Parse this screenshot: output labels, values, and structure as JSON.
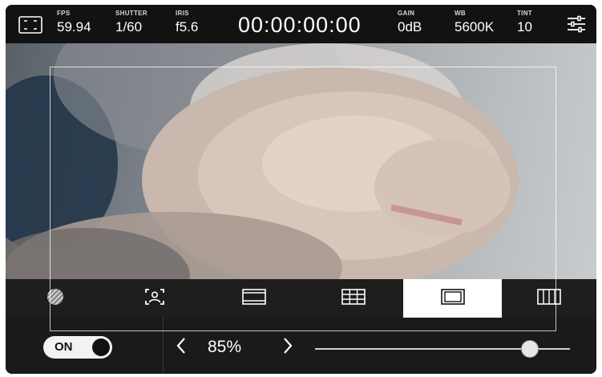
{
  "topbar": {
    "fps": {
      "label": "FPS",
      "value": "59.94"
    },
    "shutter": {
      "label": "SHUTTER",
      "value": "1/60"
    },
    "iris": {
      "label": "IRIS",
      "value": "f5.6"
    },
    "timecode": "00:00:00:00",
    "gain": {
      "label": "GAIN",
      "value": "0dB"
    },
    "wb": {
      "label": "WB",
      "value": "5600K"
    },
    "tint": {
      "label": "TINT",
      "value": "10"
    }
  },
  "icons": {
    "left": "fullscreen-frame-icon",
    "right": "settings-sliders-icon"
  },
  "tabs": [
    {
      "name": "zebra",
      "icon": "zebra-icon"
    },
    {
      "name": "focus-assist",
      "icon": "focus-assist-icon"
    },
    {
      "name": "frame-guides",
      "icon": "frame-guides-icon"
    },
    {
      "name": "grids",
      "icon": "grid-icon"
    },
    {
      "name": "safe-area",
      "icon": "safe-area-icon",
      "active": true
    },
    {
      "name": "false-color",
      "icon": "false-color-icon"
    }
  ],
  "controls": {
    "toggle_label": "ON",
    "toggle_state": "on",
    "percent": "85%",
    "slider_value": 0.85
  },
  "colors": {
    "bar": "#121212",
    "active_tab": "#ffffff",
    "text": "#ffffff"
  }
}
